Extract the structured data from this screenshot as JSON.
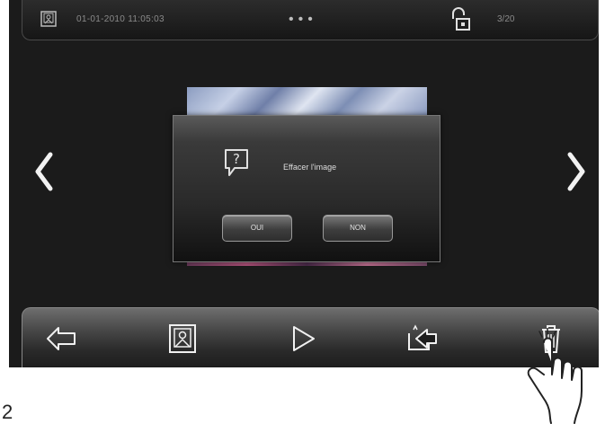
{
  "status_bar": {
    "datetime": "01-01-2010  11:05:03",
    "page_dots": "•••",
    "counter": "3/20",
    "icons": [
      "gallery-icon",
      "unlock-icon"
    ]
  },
  "dialog": {
    "message": "Effacer l'image",
    "yes_label": "OUI",
    "no_label": "NON",
    "icon": "question-bubble-icon"
  },
  "navigation": {
    "previous_icon": "chevron-left-icon",
    "next_icon": "chevron-right-icon"
  },
  "toolbar": {
    "items": [
      "back-arrow-icon",
      "gallery-icon",
      "play-icon",
      "export-icon",
      "trash-icon"
    ]
  },
  "figure": {
    "page_number": "2"
  },
  "colors": {
    "screen_bg": "#1b1b1b",
    "dialog_text": "#dcdcdc",
    "accent_gray": "#8a8a8a"
  }
}
